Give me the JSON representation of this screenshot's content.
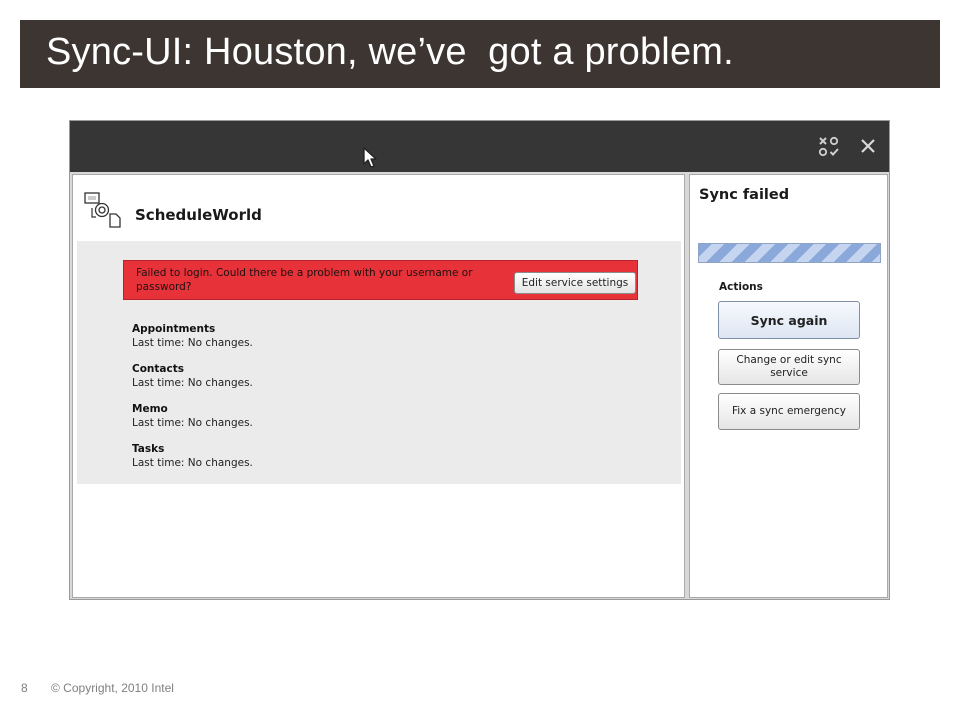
{
  "slide": {
    "title": "Sync-UI: Houston, we’ve  got a problem.",
    "number": "8",
    "copyright": "© Copyright, 2010 Intel"
  },
  "colors": {
    "title_bar": "#3c3531",
    "app_topbar": "#363636",
    "error_banner": "#e8323a",
    "progress_stripe": "#8aa8da"
  },
  "app": {
    "topbar_icons": [
      "cursor-icon",
      "emergency-icon",
      "close-icon"
    ],
    "service": {
      "icon": "sync-service-icon",
      "name": "ScheduleWorld"
    },
    "error": {
      "message": "Failed to login. Could there be a problem with your username or password?",
      "button_label": "Edit service settings"
    },
    "sources": [
      {
        "name": "Appointments",
        "status": "Last time: No changes."
      },
      {
        "name": "Contacts",
        "status": "Last time: No changes."
      },
      {
        "name": "Memo",
        "status": "Last time: No changes."
      },
      {
        "name": "Tasks",
        "status": "Last time: No changes."
      }
    ],
    "status_panel": {
      "heading": "Sync failed",
      "progress_style": "indeterminate-striped",
      "actions_heading": "Actions",
      "actions": [
        {
          "label": "Sync again"
        },
        {
          "label": "Change or edit sync service"
        },
        {
          "label": "Fix a sync emergency"
        }
      ]
    }
  }
}
